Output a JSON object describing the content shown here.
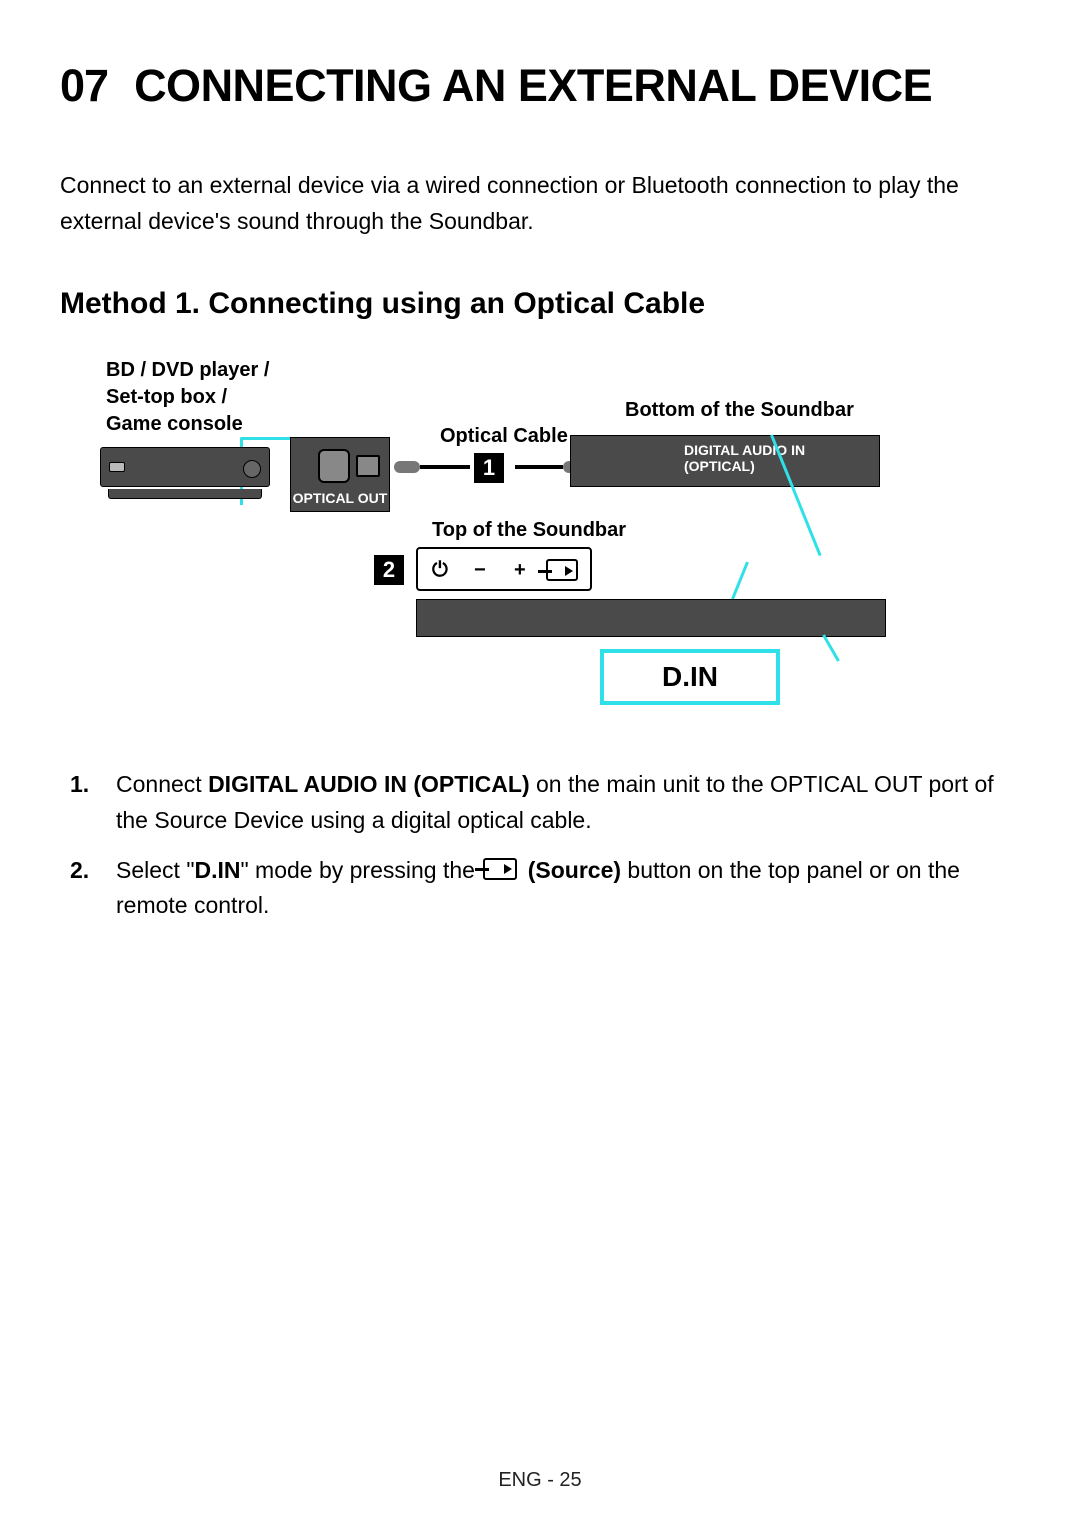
{
  "section": {
    "number": "07",
    "title": "CONNECTING AN EXTERNAL DEVICE"
  },
  "intro": "Connect to an external device via a wired connection or Bluetooth connection to play the external device's sound through the Soundbar.",
  "method": {
    "title": "Method 1. Connecting using an Optical Cable"
  },
  "diagram": {
    "source_label": "BD / DVD player /\nSet-top box /\nGame console",
    "cable_label": "Optical Cable",
    "soundbar_bottom_label": "Bottom of the Soundbar",
    "soundbar_top_label": "Top of the Soundbar",
    "optical_out": "OPTICAL OUT",
    "digital_audio_in_1": "DIGITAL AUDIO IN",
    "digital_audio_in_2": "(OPTICAL)",
    "display_mode": "D.IN",
    "step1": "1",
    "step2": "2",
    "icons": {
      "power": "⏻",
      "minus": "−",
      "plus": "+"
    }
  },
  "steps": [
    {
      "num": "1.",
      "pre": "Connect ",
      "bold1": "DIGITAL AUDIO IN (OPTICAL)",
      "post": " on the main unit to the OPTICAL OUT port of the Source Device using a digital optical cable."
    },
    {
      "num": "2.",
      "pre": "Select \"",
      "bold1": "D.IN",
      "mid": "\" mode by pressing the ",
      "bold2": "(Source)",
      "post": " button on the top panel or on the remote control."
    }
  ],
  "footer": "ENG - 25"
}
